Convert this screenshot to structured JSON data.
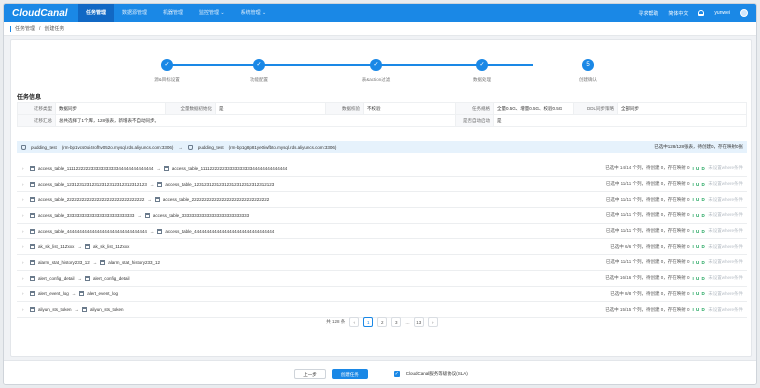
{
  "app": {
    "logo": "CloudCanal",
    "nav": [
      "任务管理",
      "数据源管理",
      "机器管理",
      "监控管理 ⌄",
      "系统管理 ⌄"
    ],
    "help": "寻求帮助",
    "lang": "简体中文",
    "user": "yunwei"
  },
  "breadcrumb": {
    "parent": "任务管理",
    "sep": "/",
    "current": "创建任务"
  },
  "steps": [
    "源&目标设置",
    "功能配置",
    "表&action过滤",
    "数据处理",
    "创建确认"
  ],
  "task_info": {
    "title": "任务信息",
    "row1": [
      {
        "k": "迁移类型",
        "v": "数据同步"
      },
      {
        "k": "全量数据初始化",
        "v": "是"
      },
      {
        "k": "数据校验",
        "v": "不校验"
      },
      {
        "k": "任务规格",
        "v": "全量0.5G、增量0.5G、校验0.5G"
      },
      {
        "k": "DDL同步策略",
        "v": "全部同步"
      }
    ],
    "row2": [
      {
        "k": "迁移汇总",
        "v": "总共选择了1个库，128张表，新增表不自动同步。"
      },
      {
        "k": "是否自动启动",
        "v": "是"
      }
    ]
  },
  "db_bar": {
    "src_db": "pudding_test",
    "src_host": "(rm-bp1vcs0oi4rofhv052o.mysql.rds.aliyuncs.com:3306)",
    "dst_db": "pudding_test",
    "dst_host": "(rm-bp1g8p81ye0iwfbto.mysql.rds.aliyuncs.com:3306)",
    "summary": "已选中128/128张表，待创建0，存在映射0张"
  },
  "tables": [
    {
      "src": "access_table_11112222223333333333344444444444444",
      "dst": "access_table_11112222223333333333344444444444444",
      "status": "已选中 14/14 个列，待创建 0，存在映射 0",
      "ops": "I U D",
      "where": "未设置where条件"
    },
    {
      "src": "access_table_12312312312312312312312312312123",
      "dst": "access_table_12312312312312312312312312312123",
      "status": "已选中 11/11 个列，待创建 0，存在映射 0",
      "ops": "I U D",
      "where": "未设置where条件"
    },
    {
      "src": "access_table_2222222222222222222222222222222",
      "dst": "access_table_2222222222222222222222222222222",
      "status": "已选中 11/11 个列，待创建 0，存在映射 0",
      "ops": "I U D",
      "where": "未设置where条件"
    },
    {
      "src": "access_table_333333333333333333333333333",
      "dst": "access_table_333333333333333333333333333",
      "status": "已选中 11/11 个列，待创建 0，存在映射 0",
      "ops": "I U D",
      "where": "未设置where条件"
    },
    {
      "src": "access_table_44444444444444444444444444444444",
      "dst": "access_table_44444444444444444444444444444444",
      "status": "已选中 11/11 个列，待创建 0，存在映射 0",
      "ops": "I U D",
      "where": "未设置where条件"
    },
    {
      "src": "ak_sk_list_11Zxxx",
      "dst": "ak_sk_list_11Zxxx",
      "status": "已选中 6/6 个列，待创建 0，存在映射 0",
      "ops": "I U D",
      "where": "未设置where条件"
    },
    {
      "src": "alarm_stat_history233_12",
      "dst": "alarm_stat_history233_12",
      "status": "已选中 11/11 个列，待创建 0，存在映射 0",
      "ops": "I U D",
      "where": "未设置where条件"
    },
    {
      "src": "alert_config_detail",
      "dst": "alert_config_detail",
      "status": "已选中 16/16 个列，待创建 0，存在映射 0",
      "ops": "I U D",
      "where": "未设置where条件"
    },
    {
      "src": "alert_event_log",
      "dst": "alert_event_log",
      "status": "已选中 8/8 个列，待创建 0，存在映射 0",
      "ops": "I U D",
      "where": "未设置where条件"
    },
    {
      "src": "aliyun_sts_token",
      "dst": "aliyun_sts_token",
      "status": "已选中 15/15 个列，待创建 0，存在映射 0",
      "ops": "I U D",
      "where": "未设置where条件"
    }
  ],
  "pager": {
    "total": "共 128 条",
    "prev": "‹",
    "pages": [
      "1",
      "2",
      "3"
    ],
    "ellipsis": "…",
    "last": "13",
    "next": "›"
  },
  "footer": {
    "prev": "上一步",
    "create": "创建任务",
    "sla_check": "✓",
    "sla": "CloudCanal服务等级协议(SLA)"
  }
}
